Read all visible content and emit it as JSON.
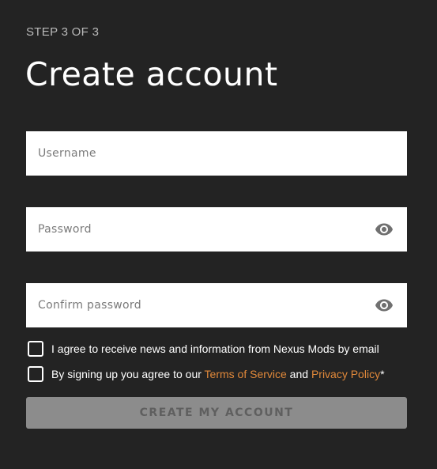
{
  "header": {
    "step_label": "STEP 3 OF 3",
    "title": "Create account"
  },
  "form": {
    "username": {
      "placeholder": "Username",
      "value": ""
    },
    "password": {
      "placeholder": "Password",
      "value": "",
      "toggle_icon": "eye-icon"
    },
    "confirm_password": {
      "placeholder": "Confirm password",
      "value": "",
      "toggle_icon": "eye-icon"
    },
    "newsletter_checkbox": {
      "checked": false,
      "label": "I agree to receive news and information from Nexus Mods by email"
    },
    "terms_checkbox": {
      "checked": false,
      "label_prefix": "By signing up you agree to our ",
      "terms_link": "Terms of Service",
      "label_middle": " and ",
      "privacy_link": "Privacy Policy",
      "required_mark": "*"
    },
    "submit_label": "CREATE MY ACCOUNT"
  },
  "colors": {
    "background": "#232323",
    "link": "#e0883a",
    "button_disabled": "#8c8c8c",
    "button_text_disabled": "#5f5f5f"
  }
}
